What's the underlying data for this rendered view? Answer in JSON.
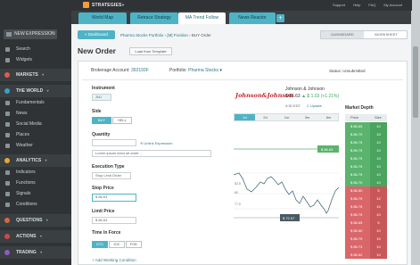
{
  "brand": {
    "name": "STRATEGIES",
    "caret": "▼"
  },
  "top_links": [
    "Support",
    "Help",
    "FAQ",
    "My Account"
  ],
  "tabs": [
    {
      "label": "World Map",
      "active": false
    },
    {
      "label": "Retrace Strategy",
      "active": false
    },
    {
      "label": "MA Trend Follow",
      "active": true
    },
    {
      "label": "News Reactor",
      "active": false
    }
  ],
  "tab_add": "+",
  "sidebar": {
    "new_expression": "NEW EXPRESSION",
    "search": "Search",
    "widgets": "Widgets",
    "markets": "MARKETS",
    "the_world": "THE WORLD",
    "world_items": [
      "Fundamentals",
      "News",
      "Social Media",
      "Places",
      "Weather"
    ],
    "analytics": "ANALYTICS",
    "analytics_items": [
      "Indicators",
      "Functions",
      "Signals",
      "Conditions"
    ],
    "questions": "QUESTIONS",
    "actions": "ACTIONS",
    "trading": "TRADING",
    "caret": "▾",
    "colors": {
      "markets": "#e35a4f",
      "the_world": "#3aa0c8",
      "analytics": "#e8a33a",
      "questions": "#d46a3a",
      "actions": "#c94a4a",
      "trading": "#8e5ac8"
    }
  },
  "breadcrumb": {
    "dashboard_button": "« Dashboard",
    "path_1": "Pharma Stocks Portfolio",
    "path_2": "[M] Position",
    "path_3": "BUY Order",
    "separator": "›"
  },
  "view_toggle": {
    "dashboard": "DASHBOARD",
    "worksheet": "WORKSHEET"
  },
  "page": {
    "title": "New Order",
    "load_button": "Load from Template"
  },
  "account": {
    "brokerage_label": "Brokerage Account:",
    "brokerage_value": "392193F",
    "portfolio_label": "Portfolio:",
    "portfolio_value": "Pharma Stocks",
    "portfolio_caret": "▾",
    "status_label": "Status:",
    "status_value": "Unsubmitted"
  },
  "form": {
    "instrument_label": "Instrument",
    "instrument_value": "JNJ",
    "side_label": "Side",
    "side_buy": "BUY",
    "side_sell": "SELL",
    "quantity_label": "Quantity",
    "quantity_value": "",
    "unit_link": "Unlink Expression",
    "unit_link_icon": "⟲",
    "note_value": "Lorem ipsum dolor sit amet ...",
    "execution_label": "Execution Type",
    "execution_value": "Stop Limit Order",
    "stop_label": "Stop Price",
    "stop_value": "$ 86.63",
    "limit_label": "Limit Price",
    "limit_value": "$ 86.63",
    "tif_label": "Time In Force",
    "tif_gtc": "GTC",
    "tif_ioc": "IOC",
    "tif_fok": "FOK",
    "add_condition": "+ Add Working Condition"
  },
  "quote": {
    "logo_text": "Johnson&Johnson",
    "company": "Johnson & Johnson",
    "price": "$ 86.63",
    "change": "▲ $ 1.03 (+1.21%)",
    "time": "4:30 EDT",
    "update_link": "C Update"
  },
  "chart_tabs": [
    "1d",
    "2d",
    "1m",
    "3m",
    "6m"
  ],
  "chart_tab_active": "1d",
  "chart_labels": {
    "last_tag": "$ 86.63",
    "low_tag": "$ 72.97",
    "y_ticks": [
      "82.5",
      "80",
      "77.5"
    ]
  },
  "market_depth": {
    "title": "Market Depth",
    "col_price": "Price",
    "col_size": "Size",
    "bid_color": "#5bb36e",
    "ask_color": "#d9676a",
    "rows": [
      {
        "price": "$ 86.65",
        "size": "10",
        "side": "bid"
      },
      {
        "price": "$ 86.70",
        "size": "15",
        "side": "bid"
      },
      {
        "price": "$ 86.75",
        "size": "10",
        "side": "bid"
      },
      {
        "price": "$ 86.75",
        "size": "10",
        "side": "bid"
      },
      {
        "price": "$ 86.75",
        "size": "15",
        "side": "bid"
      },
      {
        "price": "$ 86.75",
        "size": "10",
        "side": "bid"
      },
      {
        "price": "$ 86.75",
        "size": "10",
        "side": "bid"
      },
      {
        "price": "$ 86.70",
        "size": "10",
        "side": "bid"
      },
      {
        "price": "$ 86.60",
        "size": "5",
        "side": "ask"
      },
      {
        "price": "$ 86.79",
        "size": "12",
        "side": "ask"
      },
      {
        "price": "$ 86.75",
        "size": "15",
        "side": "ask"
      },
      {
        "price": "$ 86.75",
        "size": "10",
        "side": "ask"
      },
      {
        "price": "$ 86.65",
        "size": "5",
        "side": "ask"
      },
      {
        "price": "$ 86.60",
        "size": "10",
        "side": "ask"
      },
      {
        "price": "$ 86.79",
        "size": "15",
        "side": "ask"
      },
      {
        "price": "$ 86.73",
        "size": "10",
        "side": "ask"
      },
      {
        "price": "$ 86.62",
        "size": "10",
        "side": "ask"
      }
    ]
  }
}
